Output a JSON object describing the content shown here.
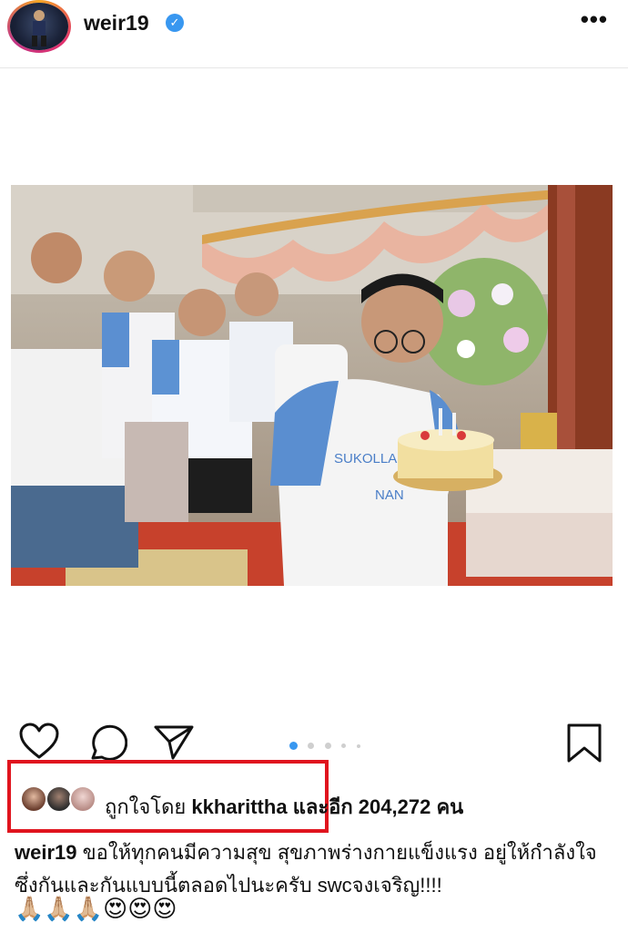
{
  "post": {
    "username": "weir19",
    "verified_badge": "✓",
    "more_label": "•••"
  },
  "likes": {
    "prefix": "ถูกใจโดย",
    "user": "kkharittha",
    "suffix": "และอีก 204,272 คน"
  },
  "caption": {
    "username": "weir19",
    "text": "ขอให้ทุกคนมีความสุข สุขภาพร่างกายแข็งแรง อยู่ให้กำลังใจซึ่งกันและกันแบบนี้ตลอดไปนะครับ swcจงเจริญ!!!!",
    "emojis": "🙏🏼🙏🏼🙏🏼😍😍😍"
  },
  "photo": {
    "shirt_text_1": "SUKOLLA",
    "shirt_text_2": "NAN"
  },
  "carousel": {
    "count": 5,
    "active_index": 0
  },
  "icons": [
    "heart-icon",
    "comment-icon",
    "share-icon",
    "bookmark-icon",
    "verified-icon",
    "more-icon"
  ],
  "colors": {
    "verified": "#3897f0",
    "highlight_box": "#e0141e",
    "active_dot": "#3897f0"
  }
}
